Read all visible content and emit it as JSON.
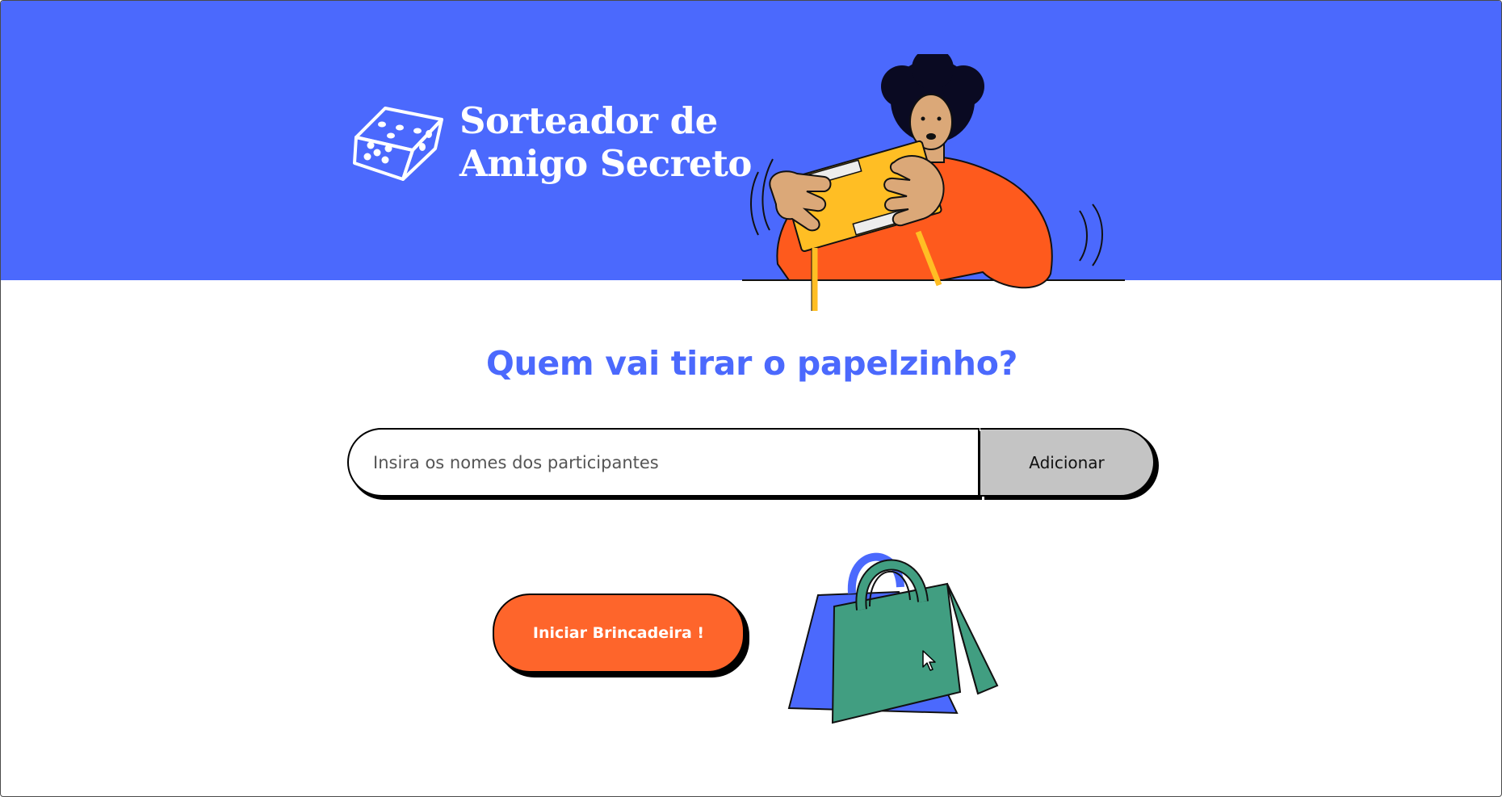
{
  "header": {
    "logo_line1": "Sorteador de",
    "logo_line2": "Amigo Secreto",
    "logo_icon": "dice-icon",
    "hero_illustration": "person-opening-gift-box",
    "background_color": "#4B69FD"
  },
  "main": {
    "title": "Quem vai tirar o papelzinho?",
    "name_input": {
      "placeholder": "Insira os nomes dos participantes",
      "value": ""
    },
    "add_button_label": "Adicionar",
    "start_button_label": "Iniciar Brincadeira !",
    "decoration": "shopping-bags"
  },
  "colors": {
    "primary_blue": "#4B69FD",
    "accent_orange": "#FE652B",
    "button_gray": "#C4C4C4",
    "bag_green": "#419E81"
  }
}
